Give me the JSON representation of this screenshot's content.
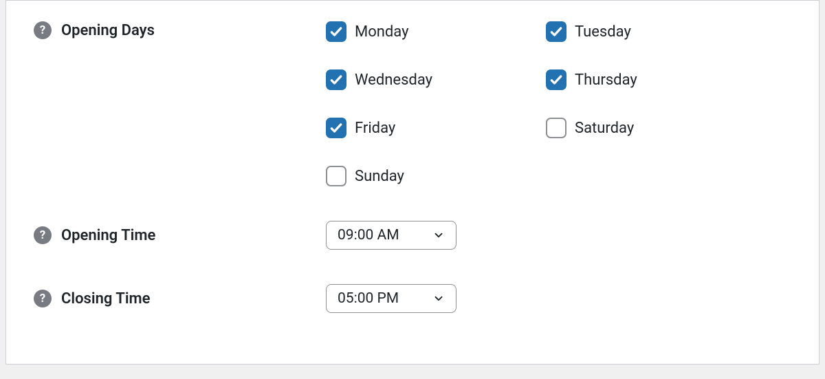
{
  "fields": {
    "opening_days": {
      "label": "Opening Days",
      "days": [
        {
          "label": "Monday",
          "checked": true
        },
        {
          "label": "Tuesday",
          "checked": true
        },
        {
          "label": "Wednesday",
          "checked": true
        },
        {
          "label": "Thursday",
          "checked": true
        },
        {
          "label": "Friday",
          "checked": true
        },
        {
          "label": "Saturday",
          "checked": false
        },
        {
          "label": "Sunday",
          "checked": false
        }
      ]
    },
    "opening_time": {
      "label": "Opening Time",
      "value": "09:00 AM"
    },
    "closing_time": {
      "label": "Closing Time",
      "value": "05:00 PM"
    }
  }
}
